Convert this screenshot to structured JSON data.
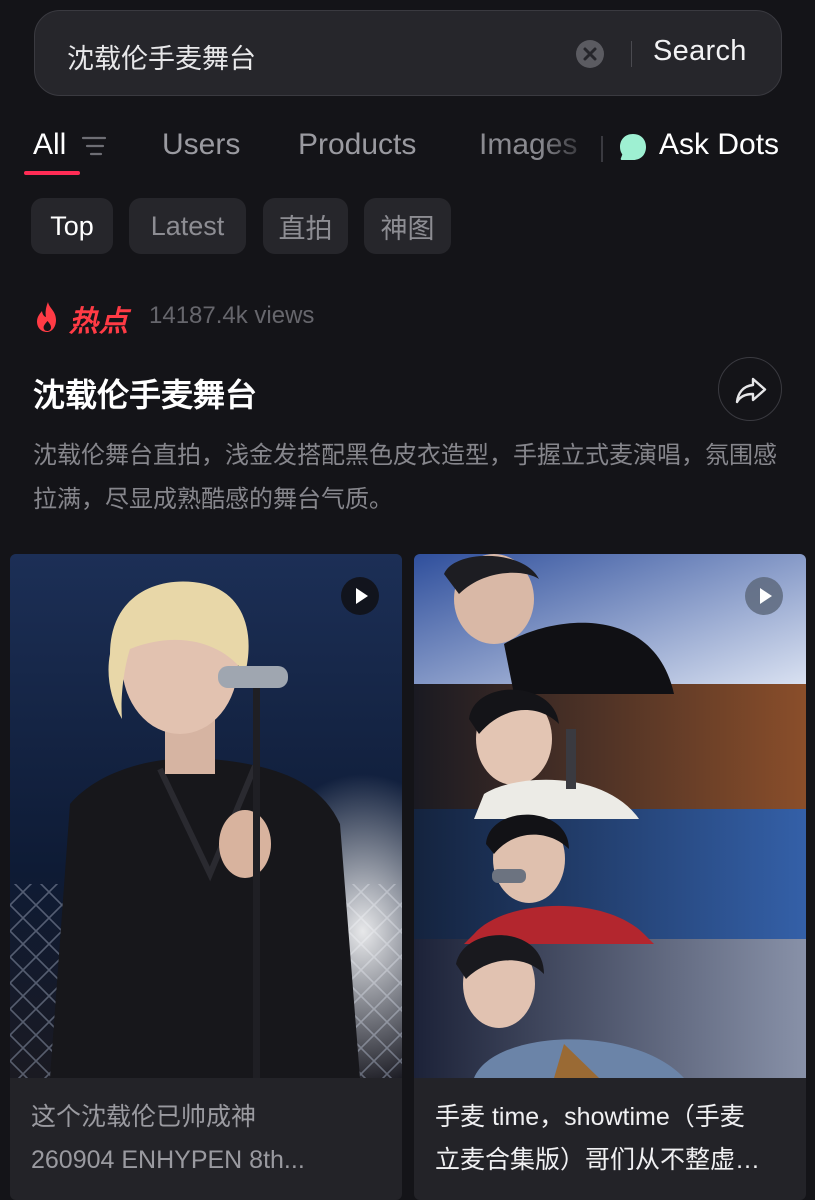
{
  "search": {
    "query": "沈载伦手麦舞台",
    "button_label": "Search"
  },
  "tabs": [
    {
      "label": "All",
      "active": true
    },
    {
      "label": "Users"
    },
    {
      "label": "Products"
    },
    {
      "label": "Images"
    },
    {
      "label": "Ask Dots"
    }
  ],
  "filters": [
    "Top",
    "Latest",
    "直拍",
    "神图"
  ],
  "topic": {
    "badge": "热点",
    "views": "14187.4k views",
    "title": "沈载伦手麦舞台",
    "description": "沈载伦舞台直拍，浅金发搭配黑色皮衣造型，手握立式麦演唱，氛围感拉满，尽显成熟酷感的舞台气质。"
  },
  "cards": [
    {
      "caption_line1": "这个沈载伦已帅成神",
      "caption_line2": "260904 ENHYPEN 8th...",
      "media": "video"
    },
    {
      "caption_line1": "手麦 time，showtime（手麦",
      "caption_line2": "立麦合集版）哥们从不整虚…",
      "media": "video"
    }
  ],
  "colors": {
    "background": "#141418",
    "accent": "#ff2c55",
    "hot": "#ff3b45",
    "ask_dots": "#9ef0d2"
  },
  "icons": {
    "clear": "clear-icon",
    "filter": "filter-icon",
    "ask_dots": "ask-dots-icon",
    "fire": "fire-icon",
    "share": "share-icon",
    "play": "play-icon"
  }
}
